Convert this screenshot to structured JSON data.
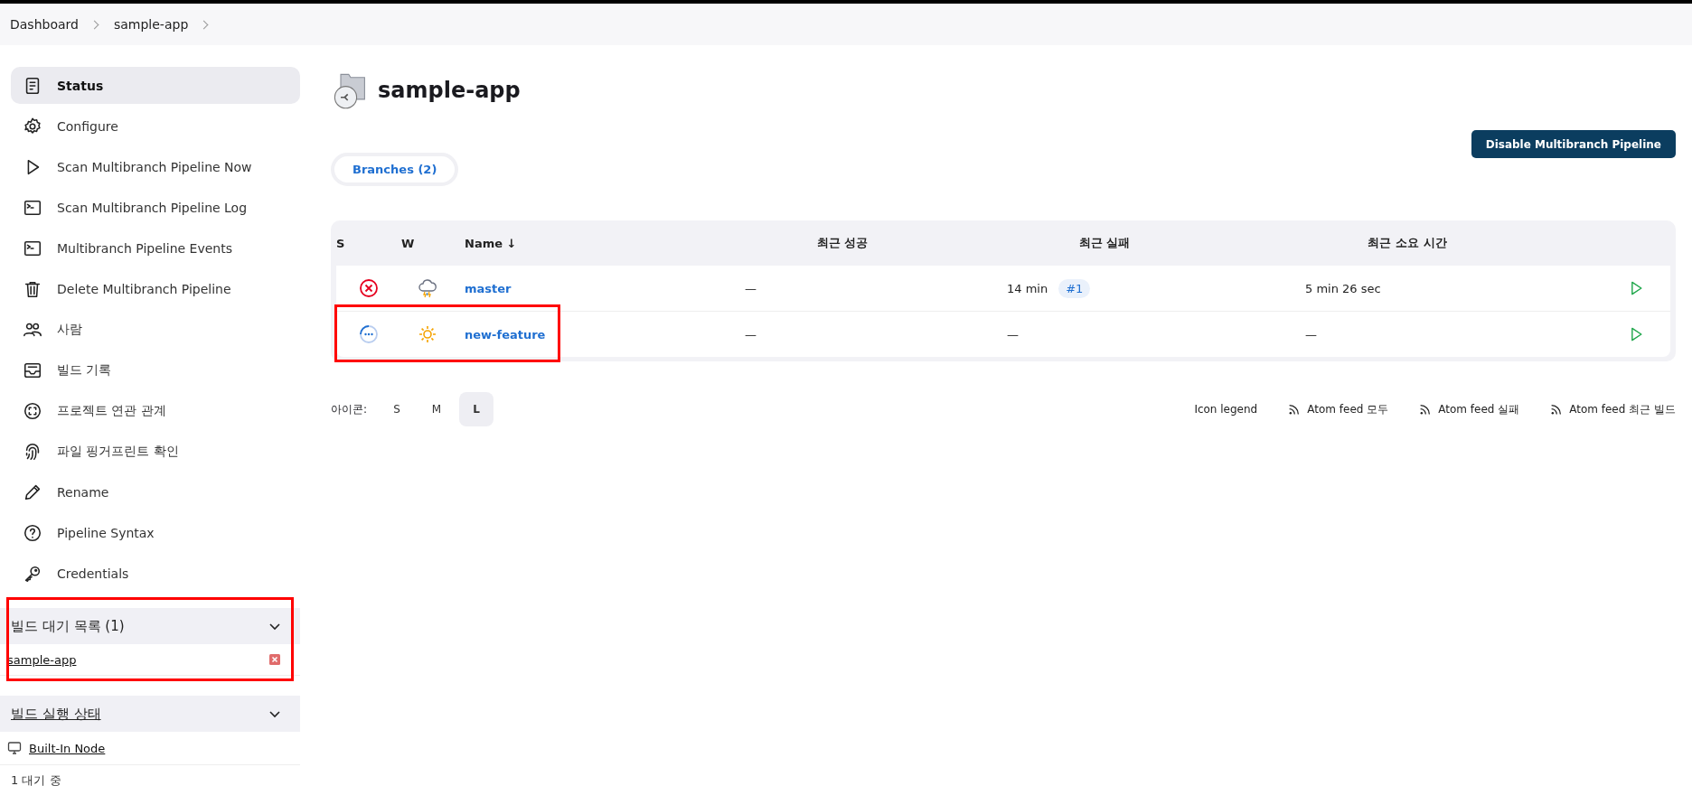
{
  "breadcrumb": [
    "Dashboard",
    "sample-app"
  ],
  "sidebar": {
    "items": [
      {
        "label": "Status",
        "selected": true
      },
      {
        "label": "Configure",
        "selected": false
      },
      {
        "label": "Scan Multibranch Pipeline Now",
        "selected": false
      },
      {
        "label": "Scan Multibranch Pipeline Log",
        "selected": false
      },
      {
        "label": "Multibranch Pipeline Events",
        "selected": false
      },
      {
        "label": "Delete Multibranch Pipeline",
        "selected": false
      },
      {
        "label": "사람",
        "selected": false
      },
      {
        "label": "빌드 기록",
        "selected": false
      },
      {
        "label": "프로젝트 연관 관계",
        "selected": false
      },
      {
        "label": "파일 핑거프린트 확인",
        "selected": false
      },
      {
        "label": "Rename",
        "selected": false
      },
      {
        "label": "Pipeline Syntax",
        "selected": false
      },
      {
        "label": "Credentials",
        "selected": false
      }
    ],
    "queue": {
      "title": "빌드 대기 목록 (1)",
      "items": [
        "sample-app"
      ]
    },
    "executors": {
      "title": "빌드 실행 상태",
      "node": "Built-In Node",
      "status": "1  대기 중"
    }
  },
  "title": "sample-app",
  "disable_button": "Disable Multibranch Pipeline",
  "tabs": [
    {
      "label": "Branches (2)",
      "selected": true
    }
  ],
  "table": {
    "columns": [
      "S",
      "W",
      "Name  ↓",
      "최근 성공",
      "최근 실패",
      "최근 소요 시간"
    ],
    "rows": [
      {
        "kind": "failed",
        "name": "master",
        "last_success": "—",
        "last_failure": "14 min",
        "failure_build": "#1",
        "duration": "5 min 26 sec"
      },
      {
        "kind": "running",
        "name": "new-feature",
        "last_success": "—",
        "last_failure": "—",
        "failure_build": "",
        "duration": "—"
      }
    ]
  },
  "icon_size": {
    "label": "아이콘:",
    "options": [
      {
        "label": "S",
        "selected": false
      },
      {
        "label": "M",
        "selected": false
      },
      {
        "label": "L",
        "selected": true
      }
    ]
  },
  "footer_links": [
    {
      "label": "Icon legend",
      "kind": "legend"
    },
    {
      "label": "Atom feed 모두",
      "kind": "feed"
    },
    {
      "label": "Atom feed 실패",
      "kind": "feed"
    },
    {
      "label": "Atom feed 최근 빌드",
      "kind": "feed"
    }
  ]
}
